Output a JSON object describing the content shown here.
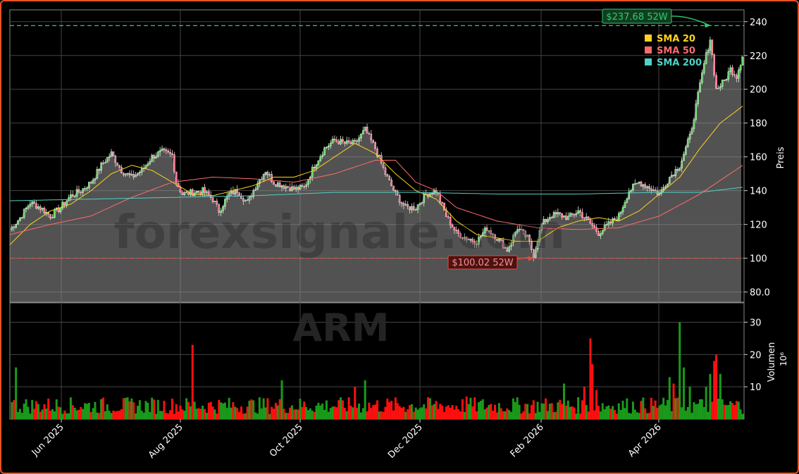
{
  "chart_data": {
    "type": "candlestick",
    "ticker": "ARM",
    "watermark": "forexsignale.com",
    "price_ylabel": "Preis",
    "volume_ylabel": "Volumen",
    "volume_unit": "10⁶",
    "price_ylim": [
      74,
      247
    ],
    "price_yticks": [
      80,
      100,
      120,
      140,
      160,
      180,
      200,
      220,
      240
    ],
    "price_ytick_labels": [
      "80.0",
      "100",
      "120",
      "140",
      "160",
      "180",
      "200",
      "220",
      "240"
    ],
    "volume_ylim": [
      0,
      36
    ],
    "volume_yticks": [
      10,
      20,
      30
    ],
    "volume_ytick_labels": [
      "10",
      "20",
      "30"
    ],
    "x_tick_labels": [
      "Jun 2025",
      "Aug 2025",
      "Oct 2025",
      "Dec 2025",
      "Feb 2026",
      "Apr 2026"
    ],
    "grid": true,
    "legend_position": "top-right",
    "legend": [
      {
        "name": "SMA 20",
        "color": "#ffd21f"
      },
      {
        "name": "SMA 50",
        "color": "#ff6b6b"
      },
      {
        "name": "SMA 200",
        "color": "#4fd1c5"
      }
    ],
    "high_52w": {
      "value": 237.68,
      "label": "$237.68 52W",
      "color": "#2ecc71"
    },
    "low_52w": {
      "value": 100.02,
      "label": "$100.02 52W",
      "color": "#e74c3c"
    },
    "last_close": 220,
    "price_anchors": [
      [
        0,
        117
      ],
      [
        5,
        124
      ],
      [
        10,
        133
      ],
      [
        15,
        130
      ],
      [
        20,
        125
      ],
      [
        25,
        130
      ],
      [
        30,
        137
      ],
      [
        35,
        140
      ],
      [
        40,
        145
      ],
      [
        45,
        155
      ],
      [
        50,
        162
      ],
      [
        55,
        152
      ],
      [
        60,
        148
      ],
      [
        65,
        152
      ],
      [
        70,
        160
      ],
      [
        75,
        163
      ],
      [
        80,
        161
      ],
      [
        82,
        145
      ],
      [
        85,
        138
      ],
      [
        90,
        139
      ],
      [
        95,
        140
      ],
      [
        100,
        135
      ],
      [
        103,
        128
      ],
      [
        108,
        138
      ],
      [
        112,
        140
      ],
      [
        117,
        133
      ],
      [
        122,
        145
      ],
      [
        126,
        152
      ],
      [
        130,
        145
      ],
      [
        135,
        143
      ],
      [
        140,
        141
      ],
      [
        145,
        142
      ],
      [
        150,
        155
      ],
      [
        155,
        165
      ],
      [
        160,
        170
      ],
      [
        165,
        168
      ],
      [
        170,
        168
      ],
      [
        175,
        176
      ],
      [
        180,
        165
      ],
      [
        185,
        150
      ],
      [
        190,
        138
      ],
      [
        195,
        130
      ],
      [
        200,
        130
      ],
      [
        205,
        138
      ],
      [
        210,
        140
      ],
      [
        215,
        125
      ],
      [
        220,
        115
      ],
      [
        225,
        112
      ],
      [
        230,
        110
      ],
      [
        235,
        118
      ],
      [
        240,
        112
      ],
      [
        245,
        105
      ],
      [
        250,
        118
      ],
      [
        255,
        112
      ],
      [
        258,
        102
      ],
      [
        262,
        120
      ],
      [
        266,
        125
      ],
      [
        270,
        126
      ],
      [
        275,
        124
      ],
      [
        280,
        128
      ],
      [
        285,
        122
      ],
      [
        290,
        115
      ],
      [
        295,
        120
      ],
      [
        300,
        125
      ],
      [
        305,
        140
      ],
      [
        310,
        145
      ],
      [
        315,
        142
      ],
      [
        320,
        138
      ],
      [
        325,
        148
      ],
      [
        330,
        155
      ],
      [
        335,
        172
      ],
      [
        338,
        190
      ],
      [
        342,
        215
      ],
      [
        345,
        230
      ],
      [
        348,
        200
      ],
      [
        352,
        205
      ],
      [
        355,
        212
      ],
      [
        358,
        208
      ],
      [
        361,
        220
      ]
    ],
    "sma20_anchors": [
      [
        0,
        108
      ],
      [
        10,
        120
      ],
      [
        20,
        128
      ],
      [
        30,
        132
      ],
      [
        40,
        140
      ],
      [
        50,
        150
      ],
      [
        60,
        155
      ],
      [
        70,
        152
      ],
      [
        80,
        145
      ],
      [
        90,
        138
      ],
      [
        100,
        137
      ],
      [
        110,
        140
      ],
      [
        120,
        143
      ],
      [
        130,
        148
      ],
      [
        140,
        148
      ],
      [
        150,
        152
      ],
      [
        160,
        160
      ],
      [
        170,
        168
      ],
      [
        180,
        162
      ],
      [
        190,
        150
      ],
      [
        200,
        140
      ],
      [
        210,
        135
      ],
      [
        220,
        122
      ],
      [
        230,
        114
      ],
      [
        240,
        112
      ],
      [
        250,
        110
      ],
      [
        260,
        110
      ],
      [
        270,
        118
      ],
      [
        280,
        122
      ],
      [
        290,
        124
      ],
      [
        300,
        122
      ],
      [
        310,
        128
      ],
      [
        320,
        138
      ],
      [
        330,
        148
      ],
      [
        340,
        165
      ],
      [
        350,
        180
      ],
      [
        361,
        190
      ]
    ],
    "sma50_anchors": [
      [
        0,
        114
      ],
      [
        20,
        120
      ],
      [
        40,
        125
      ],
      [
        60,
        136
      ],
      [
        80,
        145
      ],
      [
        100,
        148
      ],
      [
        120,
        147
      ],
      [
        140,
        145
      ],
      [
        160,
        150
      ],
      [
        180,
        158
      ],
      [
        190,
        158
      ],
      [
        200,
        145
      ],
      [
        210,
        140
      ],
      [
        220,
        130
      ],
      [
        240,
        122
      ],
      [
        260,
        118
      ],
      [
        280,
        117
      ],
      [
        300,
        118
      ],
      [
        320,
        125
      ],
      [
        340,
        138
      ],
      [
        361,
        155
      ]
    ],
    "sma200_anchors": [
      [
        0,
        134
      ],
      [
        40,
        135
      ],
      [
        80,
        136
      ],
      [
        120,
        137
      ],
      [
        160,
        139
      ],
      [
        200,
        139
      ],
      [
        240,
        138
      ],
      [
        280,
        138
      ],
      [
        320,
        139
      ],
      [
        340,
        139
      ],
      [
        361,
        142
      ]
    ],
    "volume_spikes": [
      [
        3,
        16
      ],
      [
        90,
        23
      ],
      [
        134,
        12
      ],
      [
        170,
        10
      ],
      [
        175,
        12
      ],
      [
        225,
        7
      ],
      [
        273,
        11
      ],
      [
        283,
        10
      ],
      [
        286,
        25
      ],
      [
        287,
        17
      ],
      [
        289,
        9
      ],
      [
        325,
        13
      ],
      [
        327,
        11
      ],
      [
        330,
        30
      ],
      [
        332,
        16
      ],
      [
        335,
        10
      ],
      [
        343,
        10
      ],
      [
        345,
        14
      ],
      [
        347,
        18
      ],
      [
        348,
        20
      ],
      [
        350,
        14
      ]
    ],
    "volume_baseline": 4
  }
}
